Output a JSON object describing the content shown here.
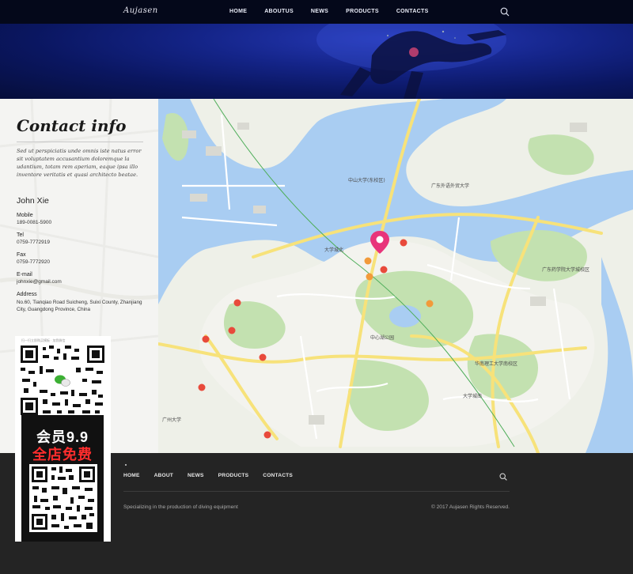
{
  "nav": {
    "logo": "Aujasen",
    "items": [
      "HOME",
      "ABOUTUS",
      "NEWS",
      "PRODUCTS",
      "CONTACTS"
    ],
    "search_icon": "search-icon"
  },
  "contact": {
    "title": "Contact info",
    "description": "Sed ut perspiciatis unde omnis iste natus error sit voluptatem accusantium doloremque la udantium, totam rem aperiam, eaque ipsa illo inventore veritatis et quasi architecto beatae.",
    "name": "John Xie",
    "mobile_label": "Mobile",
    "mobile": "189-0081-5900",
    "tel_label": "Tel",
    "tel": "0759-7772919",
    "fax_label": "Fax",
    "fax": "0759-7772920",
    "email_label": "E-mail",
    "email": "johnxie@gmail.com",
    "address_label": "Address",
    "address": "No.60, Tianqiao Road Suicheng, Suixi County, Zhanjiang City, Guangdong Province, China"
  },
  "map": {
    "labels": [
      {
        "text": "中山大学(东校区)"
      },
      {
        "text": "广东外语外贸大学"
      },
      {
        "text": "中心湖公园"
      },
      {
        "text": "华南理工大学南校区"
      },
      {
        "text": "广东药学院大学城校区"
      },
      {
        "text": "广州大学"
      },
      {
        "text": "大学城北"
      },
      {
        "text": "大学城南"
      }
    ],
    "colors": {
      "water": "#a9cdf2",
      "land": "#eef0e8",
      "green": "#c3e1b0",
      "road": "#ffffff",
      "road_major": "#f7e27a",
      "pin": "#e8347a"
    }
  },
  "promo": {
    "caption": "扫一扫立即购买模板 · 加我微信",
    "line1": "会员9.9",
    "line2": "全店免费"
  },
  "footer": {
    "items": [
      "HOME",
      "ABOUT",
      "NEWS",
      "PRODUCTS",
      "CONTACTS"
    ],
    "tagline": "Specializing in the production of diving equipment",
    "copyright": "© 2017 Aujasen Rights Reserved."
  }
}
